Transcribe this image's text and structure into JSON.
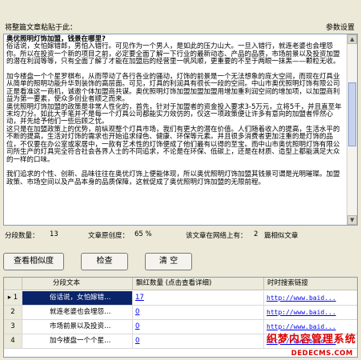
{
  "header": {
    "title": "将整篇文章粘贴于此：",
    "settings_label": "参数设置"
  },
  "article": {
    "heading": "奥优照明灯饰加盟，钱景在哪里?",
    "body": "俗话说，女怕嫁错郎，男怕入错行。可见作为一个男人，是如此的压力山大。一旦入错行，就连老婆也会埋怨你。所以在投资一个新的项目之前，必定要全面了解一下行业的最新动态、产品的品质，市场前景以及投资加盟的潜在利润等等，只有全面了解了才能在加盟后的经营里一帆风顺，更重要的不至于两眼一抹黑——颗粒无收。\n\n加今楼盘一个个星罗棋布，从而带动了各行各业的骚动，灯饰的前景是一个无法想象的庞大空间，而现在灯具业从简单的照明功能升华到装饰的高层面。可见，灯具的利润具有很长一段的空间。中山市奥优照明灯饰有限公司正是看准这一商机，诚邀个体加盟商共谋。奥优照明灯饰加盟加盟加盟用增加重利润空间的增加项，以加盟商利益为第一要素，使众多创业者顺之而来。\n奥优照明灯饰加盟的政策是非常人性化的，首先，针对于加盟者的资金投入要求3-5万元，立将5千，并且直至年末均力分。如此大手笔并不是每一个灯具公司都能实力效仿的，仅这一项政策便让许多有意向的加盟者怦然心动，并先给予他们一些后顾之忧。\n这只是在加盟政策上的优势，前纵观整个灯具市场，我们有更大的潜在价值。人们随着收入的提高，生活水平的不断的提高，生活对灯饰的需求也开始追求绿色、健康、环保等元素。并且很多消费者更加注重的是灯饰的品位，不仅要在办公室或家居中，一款有艺术性的灯饰便成了他们最有以得的至宝。而中山市奥优照明灯饰有限公司所生产的灯具完全符合社会各界人士的不同追求，不论是在环保、低碳上，还是在材质、造型上都能满足大众的一样的口味。\n\n我们追求的个性、创新、品味往往在奥优灯饰上便能体现，所以奥优照明灯饰加盟其钱景可谓是光明璀璨。加盟政策、市场空间以及产品本身的品质保障，这就促成了奥优照明灯饰加盟的无限前程。"
  },
  "stats": {
    "segments_label": "分段数量：",
    "segments_value": "13",
    "originality_label": "文章原创度：",
    "originality_value": "65 %",
    "found_label": "该文章在网络上有：",
    "found_value": "2",
    "found_suffix": "篇相似文章"
  },
  "buttons": {
    "check_similarity": "查看相似度",
    "check": "检查",
    "clear": "清 空"
  },
  "grid": {
    "columns": [
      "分段文本",
      "飘红数量 (点击查看详细)",
      "时时搜索链接"
    ],
    "rows": [
      {
        "index": "1",
        "text": "俗话说，女怕嫁错…",
        "count": "17",
        "url": "http://www.baid..."
      },
      {
        "index": "2",
        "text": "就连老婆也会埋怨…",
        "count": "0",
        "url": "http://www.baid..."
      },
      {
        "index": "3",
        "text": "市场前景以及投资…",
        "count": "0",
        "url": "http://www.baid..."
      },
      {
        "index": "4",
        "text": "加今楼盘一个个星…",
        "count": "0",
        "url": "http://www.baid..."
      }
    ]
  },
  "watermark": {
    "line1": "织梦内容管理系统",
    "line2": "DEDECMS.COM"
  },
  "colors": {
    "selection": "#0a246a",
    "link": "#0000ee",
    "watermark": "#e00000"
  }
}
